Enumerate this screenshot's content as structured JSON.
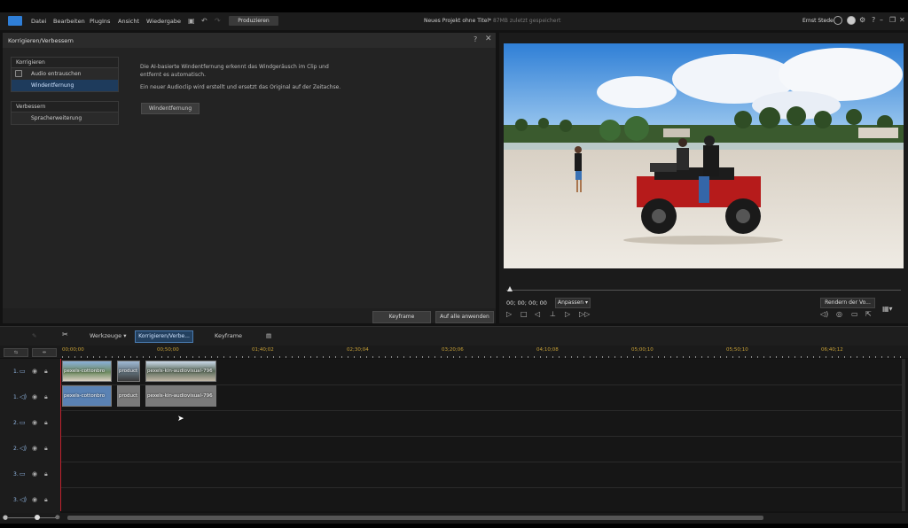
{
  "menubar": {
    "items": [
      "Datei",
      "Bearbeiten",
      "PlugIns",
      "Ansicht",
      "Wiedergabe"
    ],
    "produce_label": "Produzieren",
    "project_title": "Neues Projekt ohne Titel*",
    "project_status": "87MB zuletzt gespeichert",
    "user_name": "Ernst Stede"
  },
  "panel": {
    "title": "Korrigieren/Verbessern",
    "section1_title": "Korrigieren",
    "section1_items": [
      "Audio entrauschen",
      "Windentfernung"
    ],
    "section2_title": "Verbessern",
    "section2_items": [
      "Spracherweiterung"
    ],
    "desc1": "Die AI-basierte Windentfernung erkennt das Windgeräusch im Clip und entfernt es automatisch.",
    "desc2": "Ein neuer Audioclip wird erstellt und ersetzt das Original auf der Zeitachse.",
    "wind_button": "Windentfernung",
    "keyframe_button": "Keyframe",
    "apply_all_button": "Auf alle anwenden"
  },
  "preview": {
    "timecode": "00; 00; 00; 00",
    "fit_label": "Anpassen ▾",
    "render_label": "Rendern der Vo..."
  },
  "timeline_toolbar": {
    "tools_label": "Werkzeuge ▾",
    "korr_label": "Korrigieren/Verbe...",
    "keyframe_label": "Keyframe"
  },
  "ruler": {
    "ticks": [
      "00;00;00",
      "00;50;00",
      "01;40;02",
      "02;30;04",
      "03;20;06",
      "04;10;08",
      "05;00;10",
      "05;50;10",
      "06;40;12"
    ]
  },
  "tracks": [
    {
      "label": "1.",
      "type": "video"
    },
    {
      "label": "1.",
      "type": "audio"
    },
    {
      "label": "2.",
      "type": "video"
    },
    {
      "label": "2.",
      "type": "audio"
    },
    {
      "label": "3.",
      "type": "video"
    },
    {
      "label": "3.",
      "type": "audio"
    }
  ],
  "clips": {
    "v1_a": "pexels-cottonbro",
    "v1_b": "product",
    "v1_c": "pexels-kin-audiovisual-796",
    "a1_a": "pexels-cottonbro",
    "a1_b": "product",
    "a1_c": "pexels-kin-audiovisual-796"
  }
}
